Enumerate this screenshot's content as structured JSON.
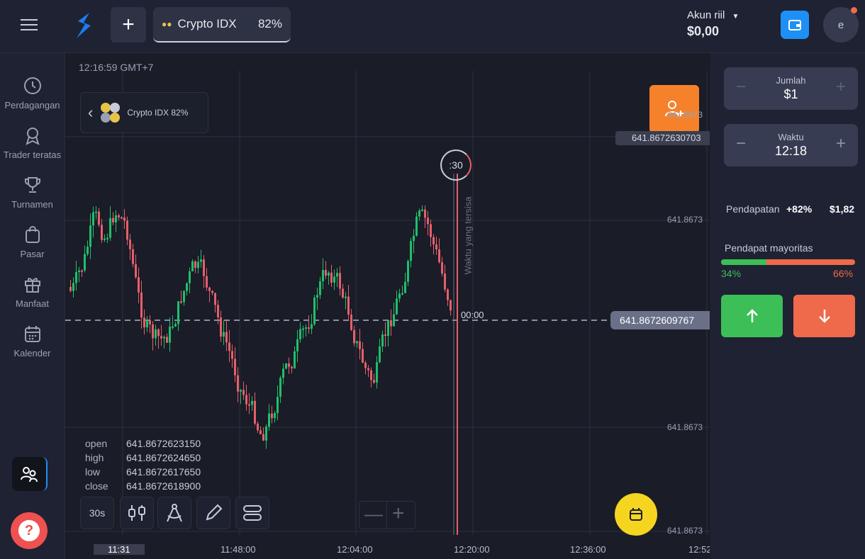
{
  "header": {
    "asset_tab": {
      "name": "Crypto IDX",
      "payout": "82%"
    },
    "account": {
      "type": "Akun riil",
      "balance": "$0,00"
    },
    "avatar_initial": "e"
  },
  "sidebar": {
    "items": [
      {
        "label": "Perdagangan",
        "icon": "clock-icon"
      },
      {
        "label": "Trader teratas",
        "icon": "award-icon"
      },
      {
        "label": "Turnamen",
        "icon": "trophy-icon"
      },
      {
        "label": "Pasar",
        "icon": "shopping-bag-icon"
      },
      {
        "label": "Manfaat",
        "icon": "gift-icon"
      },
      {
        "label": "Kalender",
        "icon": "calendar-icon"
      }
    ]
  },
  "chart": {
    "clock": "12:16:59 GMT+7",
    "asset_chip": "Crypto IDX 82%",
    "countdown": ":30",
    "remaining_label": "Waktu yang tersisa",
    "expiry_timer": "00:00",
    "top_price_tag": "641.8672630703",
    "current_price_tag": "641.8672609767",
    "price_axis": [
      "641.8673",
      "641.8673",
      "641.8673",
      "641.8673"
    ],
    "time_axis": [
      "11:31",
      "11:48:00",
      "12:04:00",
      "12:20:00",
      "12:36:00",
      "12:52"
    ],
    "ohlc": [
      {
        "k": "open",
        "v": "641.8672623150"
      },
      {
        "k": "high",
        "v": "641.8672624650"
      },
      {
        "k": "low",
        "v": "641.8672617650"
      },
      {
        "k": "close",
        "v": "641.8672618900"
      }
    ],
    "timeframe": "30s",
    "colors": {
      "up": "#1fbf6c",
      "down": "#e4606b",
      "accent": "#f5822a"
    }
  },
  "panel": {
    "amount": {
      "label": "Jumlah",
      "value": "$1"
    },
    "time": {
      "label": "Waktu",
      "value": "12:18"
    },
    "income": {
      "label": "Pendapatan",
      "percent": "+82%",
      "value": "$1,82"
    },
    "majority": {
      "label": "Pendapat mayoritas",
      "up": "34%",
      "down": "66%",
      "up_fraction": 0.34
    }
  }
}
